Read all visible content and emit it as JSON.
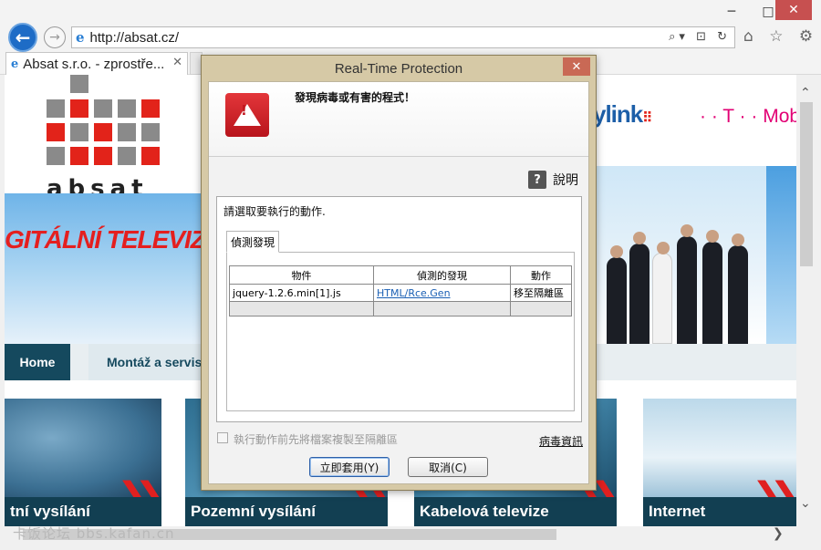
{
  "browser": {
    "window_controls": {
      "minimize": "─",
      "maximize": "□",
      "close": "✕"
    },
    "back_glyph": "←",
    "forward_glyph": "→",
    "address": {
      "icon": "e",
      "url": "http://absat.cz/",
      "tools": "⌕▾ ⊡ ↻"
    },
    "right_icons": "⌂ ☆ ⚙",
    "tab": {
      "icon": "e",
      "title": "Absat s.r.o. - zprostře...",
      "close": "✕"
    }
  },
  "website": {
    "logo_text": "absat",
    "tv_banner": "GITÁLNÍ TELEVIZE",
    "skylink": "ylink",
    "skylink_dots": "⠿",
    "tmobile": "· · T · · Mobi",
    "nav": {
      "home": "Home",
      "montaz": "Montáž a servis"
    },
    "tiles": [
      {
        "label": "tní vysílání"
      },
      {
        "label": "Pozemní vysílání"
      },
      {
        "label": "Kabelová televize"
      },
      {
        "label": "Internet"
      }
    ],
    "chevrons": "❯❯"
  },
  "scrollbars": {
    "up": "⌃",
    "down": "⌄",
    "right": "❯"
  },
  "watermark": "卡饭论坛 bbs.kafan.cn",
  "dialog": {
    "title": "Real-Time Protection",
    "close": "✕",
    "warning_text": "發現病毒或有害的程式！",
    "help_icon": "?",
    "help_label": "說明",
    "action_prompt": "請選取要執行的動作.",
    "tab_label": "偵測發現",
    "table": {
      "headers": [
        "物件",
        "偵測的發現",
        "動作"
      ],
      "rows": [
        {
          "object": "jquery-1.2.6.min[1].js",
          "detection": "HTML/Rce.Gen",
          "action": "移至隔離區"
        }
      ]
    },
    "checkbox_label": "執行動作前先將檔案複製至隔離區",
    "checkbox_checked": false,
    "virus_info_link": "病毒資訊",
    "buttons": {
      "apply": "立即套用(Y)",
      "cancel": "取消(C)"
    }
  },
  "colors": {
    "logo_red": "#e2231a",
    "logo_gray": "#8a8a8a",
    "nav_dark": "#15495e",
    "tile_label_bg": "#123f52",
    "dialog_frame": "#d6c9a6",
    "warning_red": "#c0161e",
    "link_blue": "#1a5fb4"
  }
}
